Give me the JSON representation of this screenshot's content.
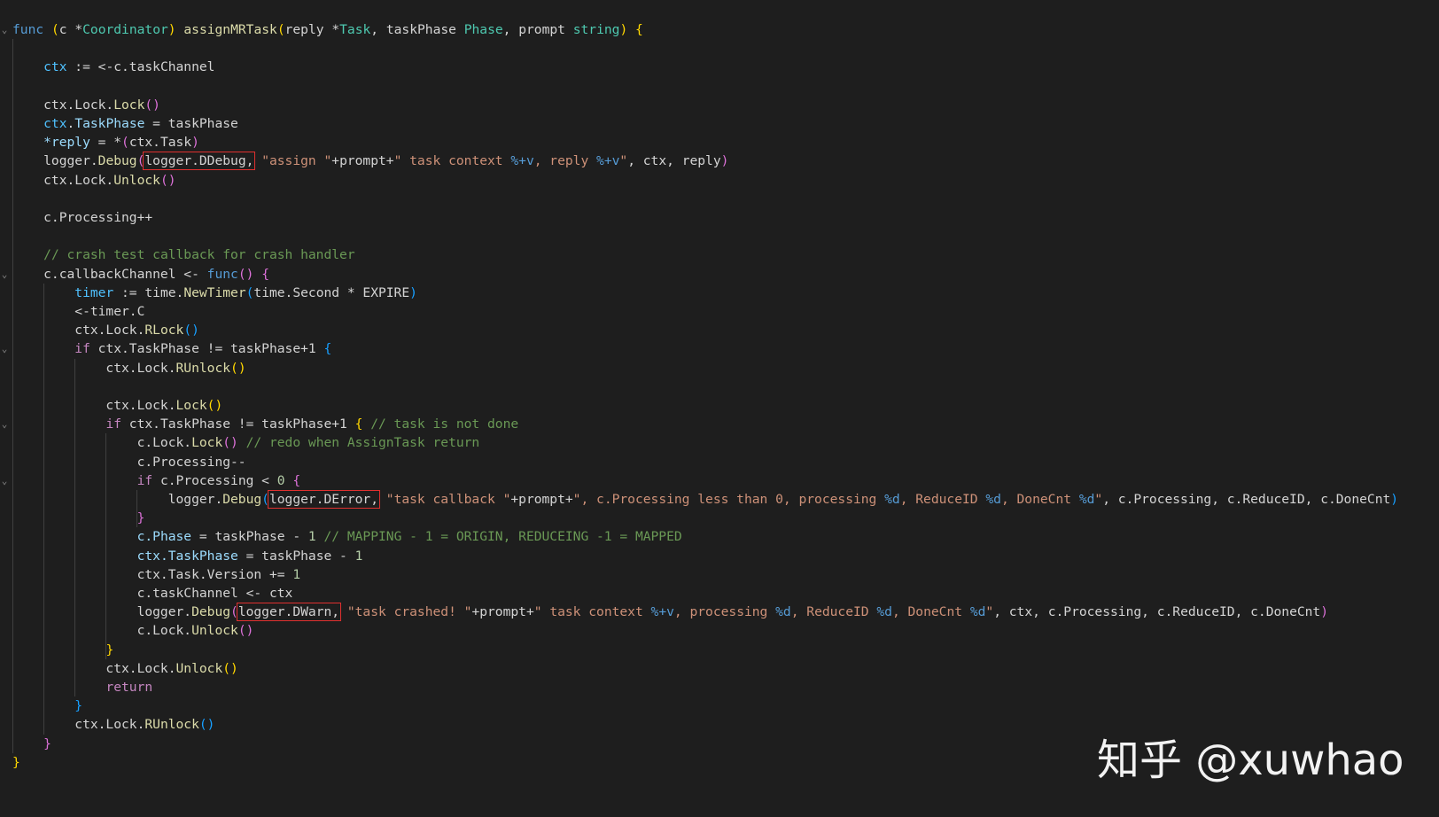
{
  "editor": {
    "lines": [
      [
        [
          "kw",
          "func"
        ],
        [
          "d",
          " "
        ],
        [
          "br1",
          "("
        ],
        [
          "d",
          "c "
        ],
        [
          "op",
          "*"
        ],
        [
          "typ",
          "Coordinator"
        ],
        [
          "br1",
          ")"
        ],
        [
          "d",
          " "
        ],
        [
          "fn",
          "assignMRTask"
        ],
        [
          "br1",
          "("
        ],
        [
          "d",
          "reply "
        ],
        [
          "op",
          "*"
        ],
        [
          "typ",
          "Task"
        ],
        [
          "d",
          ", taskPhase "
        ],
        [
          "typ",
          "Phase"
        ],
        [
          "d",
          ", prompt "
        ],
        [
          "typ",
          "string"
        ],
        [
          "br1",
          ")"
        ],
        [
          "d",
          " "
        ],
        [
          "br1",
          "{"
        ]
      ],
      [],
      [
        [
          "d",
          "    "
        ],
        [
          "blu",
          "ctx"
        ],
        [
          "d",
          " := <-c.taskChannel"
        ]
      ],
      [],
      [
        [
          "d",
          "    ctx.Lock."
        ],
        [
          "fn",
          "Lock"
        ],
        [
          "br2",
          "()"
        ]
      ],
      [
        [
          "d",
          "    "
        ],
        [
          "blu",
          "ctx"
        ],
        [
          "d",
          "."
        ],
        [
          "var",
          "TaskPhase"
        ],
        [
          "d",
          " = taskPhase"
        ]
      ],
      [
        [
          "d",
          "    "
        ],
        [
          "var",
          "*reply"
        ],
        [
          "d",
          " = *"
        ],
        [
          "br2",
          "("
        ],
        [
          "d",
          "ctx.Task"
        ],
        [
          "br2",
          ")"
        ]
      ],
      [
        [
          "d",
          "    logger."
        ],
        [
          "fn",
          "Debug"
        ],
        [
          "br2",
          "("
        ],
        [
          "box",
          "logger.DDebug,"
        ],
        [
          "d",
          " "
        ],
        [
          "str",
          "\"assign \""
        ],
        [
          "d",
          "+prompt+"
        ],
        [
          "str",
          "\" task context "
        ],
        [
          "esc",
          "%+v"
        ],
        [
          "str",
          ", reply "
        ],
        [
          "esc",
          "%+v"
        ],
        [
          "str",
          "\""
        ],
        [
          "d",
          ", ctx, reply"
        ],
        [
          "br2",
          ")"
        ]
      ],
      [
        [
          "d",
          "    ctx.Lock."
        ],
        [
          "fn",
          "Unlock"
        ],
        [
          "br2",
          "()"
        ]
      ],
      [],
      [
        [
          "d",
          "    c.Processing++"
        ]
      ],
      [],
      [
        [
          "d",
          "    "
        ],
        [
          "cmt",
          "// crash test callback for crash handler"
        ]
      ],
      [
        [
          "d",
          "    c.callbackChannel <- "
        ],
        [
          "kw",
          "func"
        ],
        [
          "br2",
          "()"
        ],
        [
          "d",
          " "
        ],
        [
          "br2",
          "{"
        ]
      ],
      [
        [
          "d",
          "        "
        ],
        [
          "blu",
          "timer"
        ],
        [
          "d",
          " := time."
        ],
        [
          "fn",
          "NewTimer"
        ],
        [
          "br3",
          "("
        ],
        [
          "d",
          "time.Second * EXPIRE"
        ],
        [
          "br3",
          ")"
        ]
      ],
      [
        [
          "d",
          "        <-timer.C"
        ]
      ],
      [
        [
          "d",
          "        ctx.Lock."
        ],
        [
          "fn",
          "RLock"
        ],
        [
          "br3",
          "()"
        ]
      ],
      [
        [
          "d",
          "        "
        ],
        [
          "ctrl",
          "if"
        ],
        [
          "d",
          " ctx.TaskPhase != taskPhase+1 "
        ],
        [
          "br3",
          "{"
        ]
      ],
      [
        [
          "d",
          "            ctx.Lock."
        ],
        [
          "fn",
          "RUnlock"
        ],
        [
          "br1",
          "()"
        ]
      ],
      [],
      [
        [
          "d",
          "            ctx.Lock."
        ],
        [
          "fn",
          "Lock"
        ],
        [
          "br1",
          "()"
        ]
      ],
      [
        [
          "d",
          "            "
        ],
        [
          "ctrl",
          "if"
        ],
        [
          "d",
          " ctx.TaskPhase != taskPhase+1 "
        ],
        [
          "br1",
          "{"
        ],
        [
          "d",
          " "
        ],
        [
          "cmt",
          "// task is not done"
        ]
      ],
      [
        [
          "d",
          "                c.Lock."
        ],
        [
          "fn",
          "Lock"
        ],
        [
          "br2",
          "()"
        ],
        [
          "d",
          " "
        ],
        [
          "cmt",
          "// redo when AssignTask return"
        ]
      ],
      [
        [
          "d",
          "                c.Processing--"
        ]
      ],
      [
        [
          "d",
          "                "
        ],
        [
          "ctrl",
          "if"
        ],
        [
          "d",
          " c.Processing < "
        ],
        [
          "num",
          "0"
        ],
        [
          "d",
          " "
        ],
        [
          "br2",
          "{"
        ]
      ],
      [
        [
          "d",
          "                    logger."
        ],
        [
          "fn",
          "Debug"
        ],
        [
          "br3",
          "("
        ],
        [
          "box",
          "logger.DError,"
        ],
        [
          "d",
          " "
        ],
        [
          "str",
          "\"task callback \""
        ],
        [
          "d",
          "+prompt+"
        ],
        [
          "str",
          "\", c.Processing less than 0, processing "
        ],
        [
          "esc",
          "%d"
        ],
        [
          "str",
          ", ReduceID "
        ],
        [
          "esc",
          "%d"
        ],
        [
          "str",
          ", DoneCnt "
        ],
        [
          "esc",
          "%d"
        ],
        [
          "str",
          "\""
        ],
        [
          "d",
          ", c.Processing, c.ReduceID, c.DoneCnt"
        ],
        [
          "br3",
          ")"
        ]
      ],
      [
        [
          "d",
          "                "
        ],
        [
          "br2",
          "}"
        ]
      ],
      [
        [
          "d",
          "                "
        ],
        [
          "var",
          "c.Phase"
        ],
        [
          "d",
          " = taskPhase - "
        ],
        [
          "num",
          "1"
        ],
        [
          "d",
          " "
        ],
        [
          "cmt",
          "// MAPPING - 1 = ORIGIN, REDUCEING -1 = MAPPED"
        ]
      ],
      [
        [
          "d",
          "                "
        ],
        [
          "var",
          "ctx.TaskPhase"
        ],
        [
          "d",
          " = taskPhase - "
        ],
        [
          "num",
          "1"
        ]
      ],
      [
        [
          "d",
          "                ctx.Task.Version += "
        ],
        [
          "num",
          "1"
        ]
      ],
      [
        [
          "d",
          "                c.taskChannel <- ctx"
        ]
      ],
      [
        [
          "d",
          "                logger."
        ],
        [
          "fn",
          "Debug"
        ],
        [
          "br2",
          "("
        ],
        [
          "box",
          "logger.DWarn,"
        ],
        [
          "d",
          " "
        ],
        [
          "str",
          "\"task crashed! \""
        ],
        [
          "d",
          "+prompt+"
        ],
        [
          "str",
          "\" task context "
        ],
        [
          "esc",
          "%+v"
        ],
        [
          "str",
          ", processing "
        ],
        [
          "esc",
          "%d"
        ],
        [
          "str",
          ", ReduceID "
        ],
        [
          "esc",
          "%d"
        ],
        [
          "str",
          ", DoneCnt "
        ],
        [
          "esc",
          "%d"
        ],
        [
          "str",
          "\""
        ],
        [
          "d",
          ", ctx, c.Processing, c.ReduceID, c.DoneCnt"
        ],
        [
          "br2",
          ")"
        ]
      ],
      [
        [
          "d",
          "                c.Lock."
        ],
        [
          "fn",
          "Unlock"
        ],
        [
          "br2",
          "()"
        ]
      ],
      [
        [
          "d",
          "            "
        ],
        [
          "br1",
          "}"
        ]
      ],
      [
        [
          "d",
          "            ctx.Lock."
        ],
        [
          "fn",
          "Unlock"
        ],
        [
          "br1",
          "()"
        ]
      ],
      [
        [
          "d",
          "            "
        ],
        [
          "ctrl",
          "return"
        ]
      ],
      [
        [
          "d",
          "        "
        ],
        [
          "br3",
          "}"
        ]
      ],
      [
        [
          "d",
          "        ctx.Lock."
        ],
        [
          "fn",
          "RUnlock"
        ],
        [
          "br3",
          "()"
        ]
      ],
      [
        [
          "d",
          "    "
        ],
        [
          "br2",
          "}"
        ]
      ],
      [
        [
          "br1",
          "}"
        ]
      ]
    ],
    "fold_marker": "⌄"
  },
  "watermark": "知乎 @xuwhao",
  "colors": {
    "background": "#1e1e1e",
    "highlight_box": "#e0302f"
  }
}
